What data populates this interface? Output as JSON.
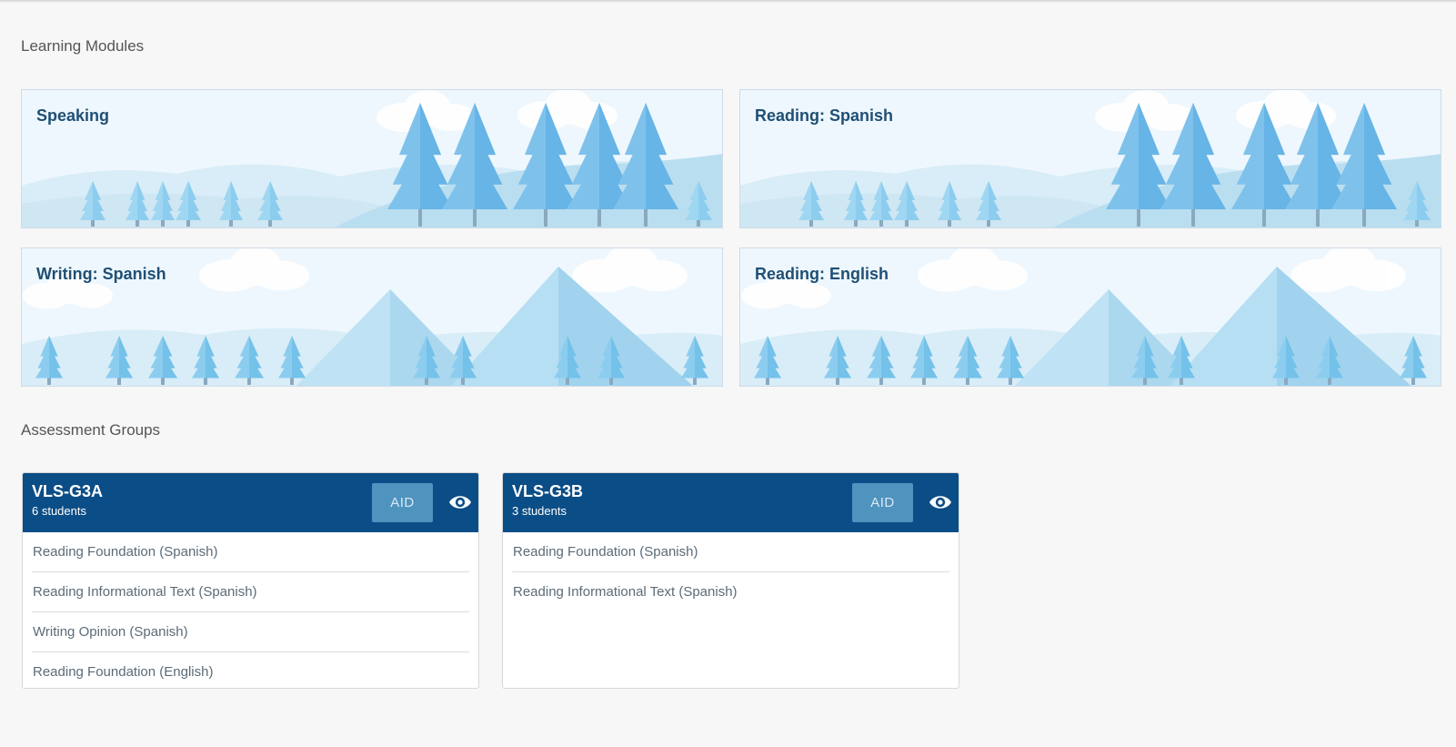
{
  "sections": {
    "learning_modules": "Learning Modules",
    "assessment_groups": "Assessment Groups"
  },
  "modules": [
    {
      "title": "Speaking",
      "scene": "forest"
    },
    {
      "title": "Reading: Spanish",
      "scene": "forest"
    },
    {
      "title": "Writing: Spanish",
      "scene": "mountains"
    },
    {
      "title": "Reading: English",
      "scene": "mountains"
    }
  ],
  "groups": [
    {
      "name": "VLS-G3A",
      "students": "6 students",
      "button": "AID",
      "items": [
        "Reading Foundation (Spanish)",
        "Reading Informational Text (Spanish)",
        "Writing Opinion (Spanish)",
        "Reading Foundation (English)"
      ]
    },
    {
      "name": "VLS-G3B",
      "students": "3 students",
      "button": "AID",
      "items": [
        "Reading Foundation (Spanish)",
        "Reading Informational Text (Spanish)"
      ]
    }
  ],
  "icons": {
    "view": "eye-icon"
  },
  "colors": {
    "header": "#0b4d86",
    "button": "#4f93bf",
    "module_title": "#1f4f74",
    "background": "#f7f7f7"
  }
}
